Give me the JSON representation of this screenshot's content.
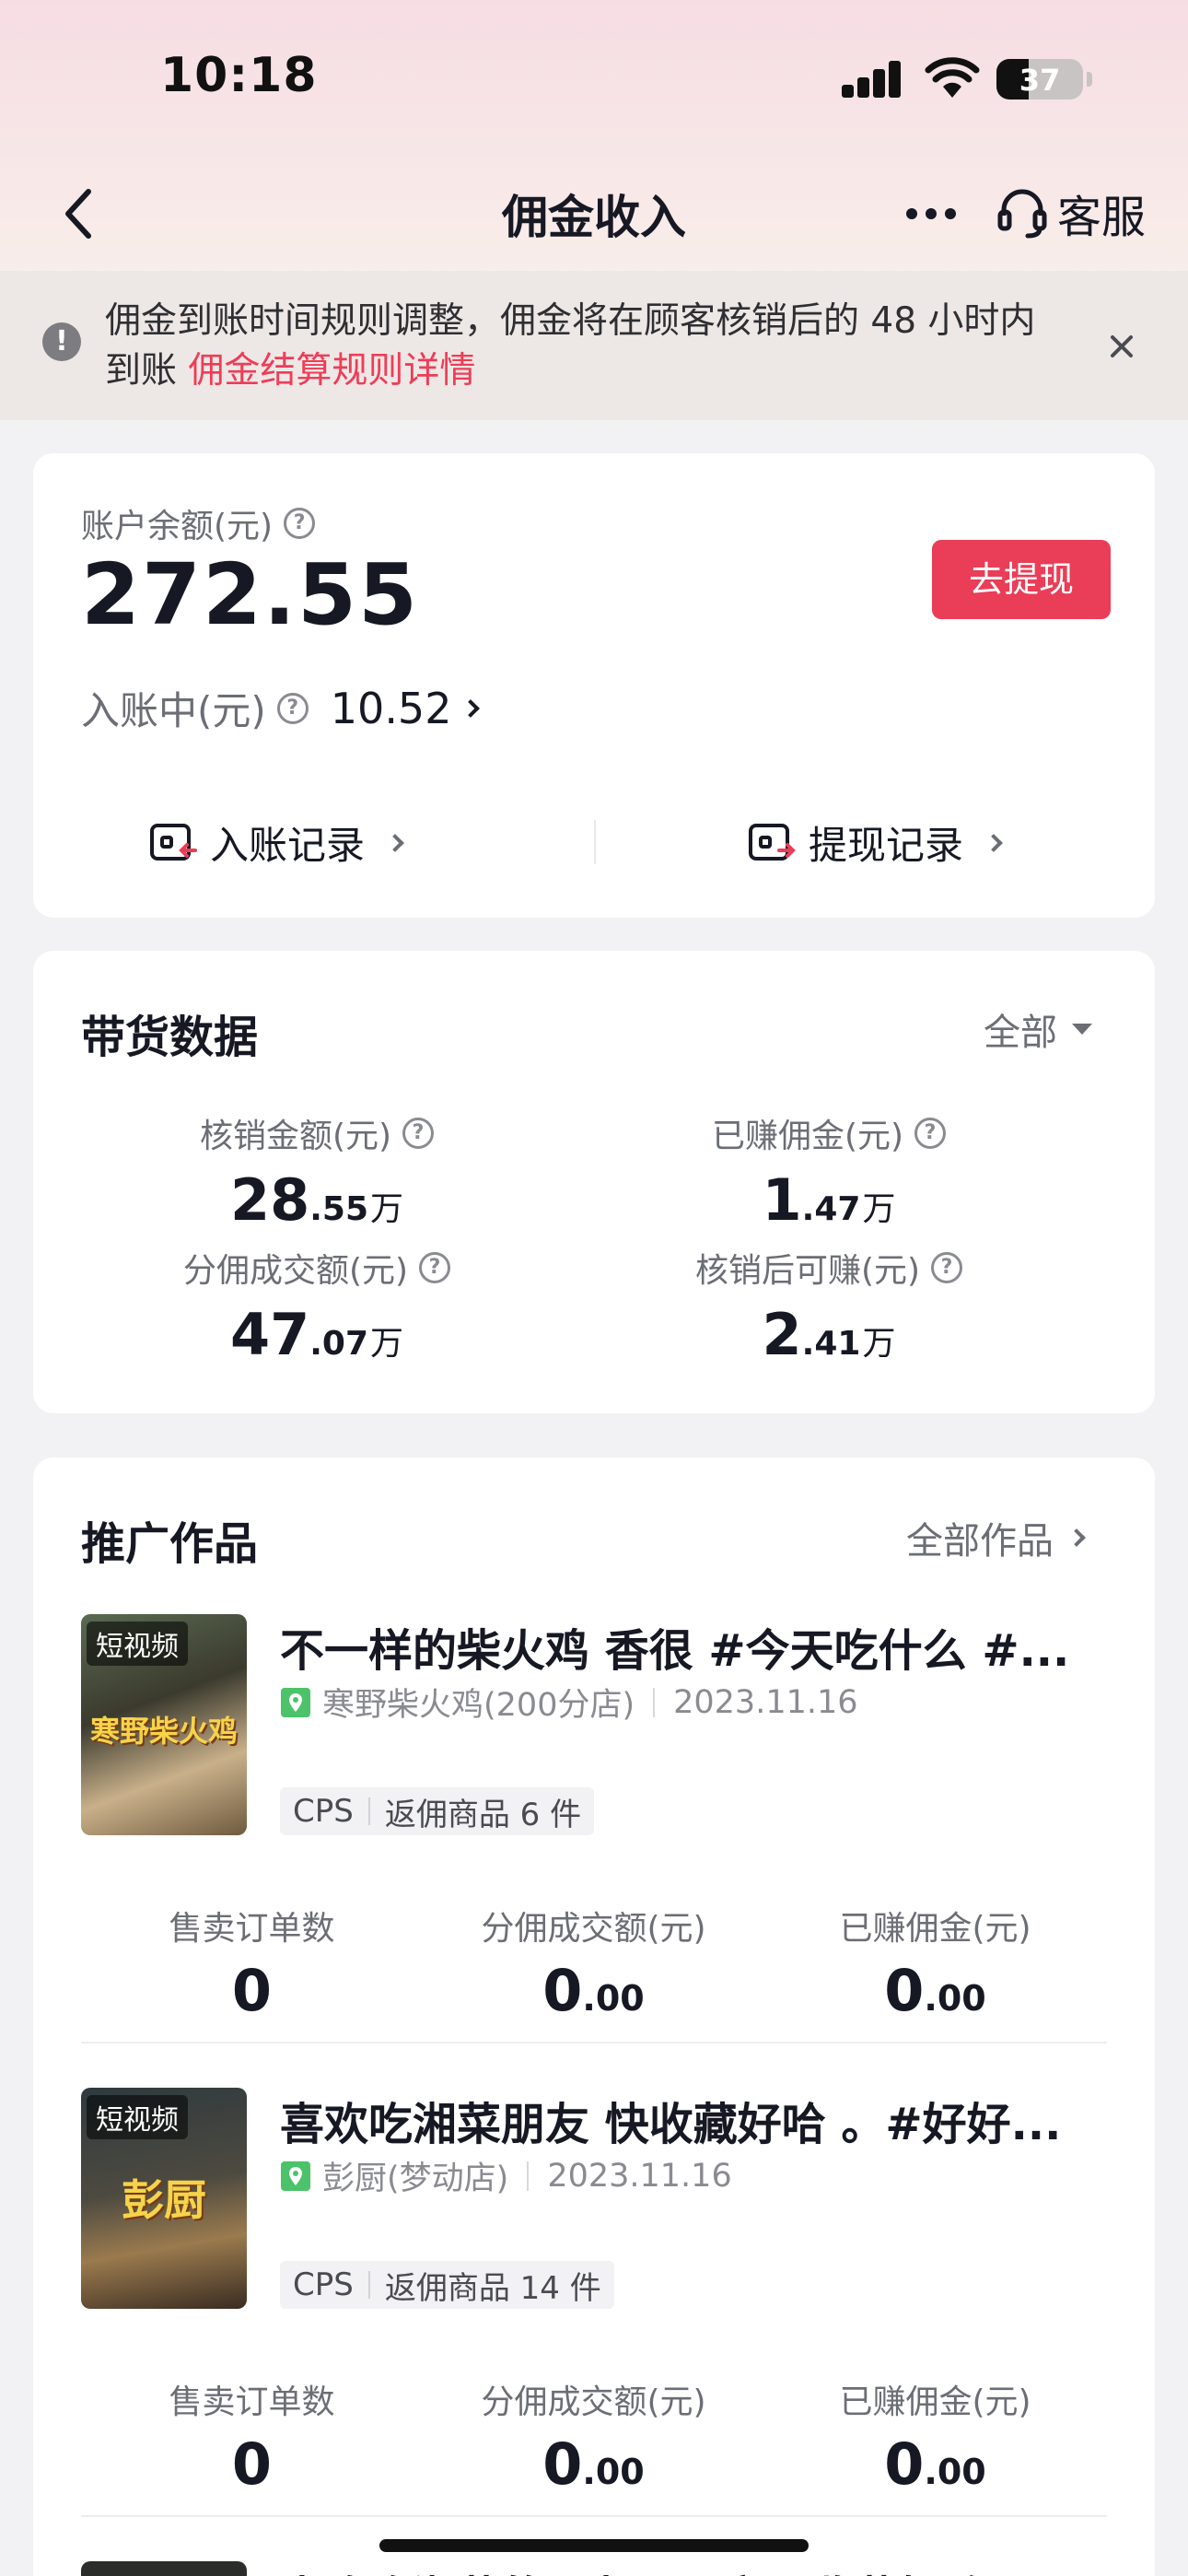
{
  "status_bar": {
    "time": "10:18",
    "battery": "37",
    "battery_level": 0.37
  },
  "nav": {
    "title": "佣金收入",
    "customer_service": "客服"
  },
  "notice": {
    "text": "佣金到账时间规则调整，佣金将在顾客核销后的 48 小时内到账",
    "link": "佣金结算规则详情"
  },
  "balance": {
    "label": "账户余额(元)",
    "amount": "272.55",
    "withdraw_button": "去提现",
    "pending_label": "入账中(元)",
    "pending_value": "10.52",
    "income_records": "入账记录",
    "withdraw_records": "提现记录"
  },
  "sales_data": {
    "title": "带货数据",
    "filter": "全部",
    "stats": [
      {
        "label": "核销金额(元)",
        "int": "28",
        "dec": ".55",
        "unit": "万"
      },
      {
        "label": "已赚佣金(元)",
        "int": "1",
        "dec": ".47",
        "unit": "万"
      },
      {
        "label": "分佣成交额(元)",
        "int": "47",
        "dec": ".07",
        "unit": "万"
      },
      {
        "label": "核销后可赚(元)",
        "int": "2",
        "dec": ".41",
        "unit": "万"
      }
    ]
  },
  "works": {
    "title": "推广作品",
    "all_link": "全部作品",
    "stat_labels": [
      "售卖订单数",
      "分佣成交额(元)",
      "已赚佣金(元)"
    ],
    "items": [
      {
        "badge": "短视频",
        "thumb_caption": "寒野柴火鸡",
        "title": "不一样的柴火鸡 香很 #今天吃什么 #...",
        "shop": "寒野柴火鸡(200分店)",
        "date": "2023.11.16",
        "tag_type": "CPS",
        "tag_goods": "返佣商品 6 件",
        "orders": "0",
        "gmv_int": "0",
        "gmv_dec": ".00",
        "commission_int": "0",
        "commission_dec": ".00"
      },
      {
        "badge": "短视频",
        "thumb_caption": "彭厨",
        "title": "喜欢吃湘菜朋友 快收藏好哈 。#好好...",
        "shop": "彭厨(梦动店)",
        "date": "2023.11.16",
        "tag_type": "CPS",
        "tag_goods": "返佣商品 14 件",
        "orders": "0",
        "gmv_int": "0",
        "gmv_dec": ".00",
        "commission_int": "0",
        "commission_dec": ".00"
      }
    ],
    "peek_title": "喜欢吃湘菜的朋友，一定要收藏好哈"
  },
  "colors": {
    "accent": "#ea3d57",
    "link": "#f03c57",
    "pin": "#4cc36a"
  }
}
